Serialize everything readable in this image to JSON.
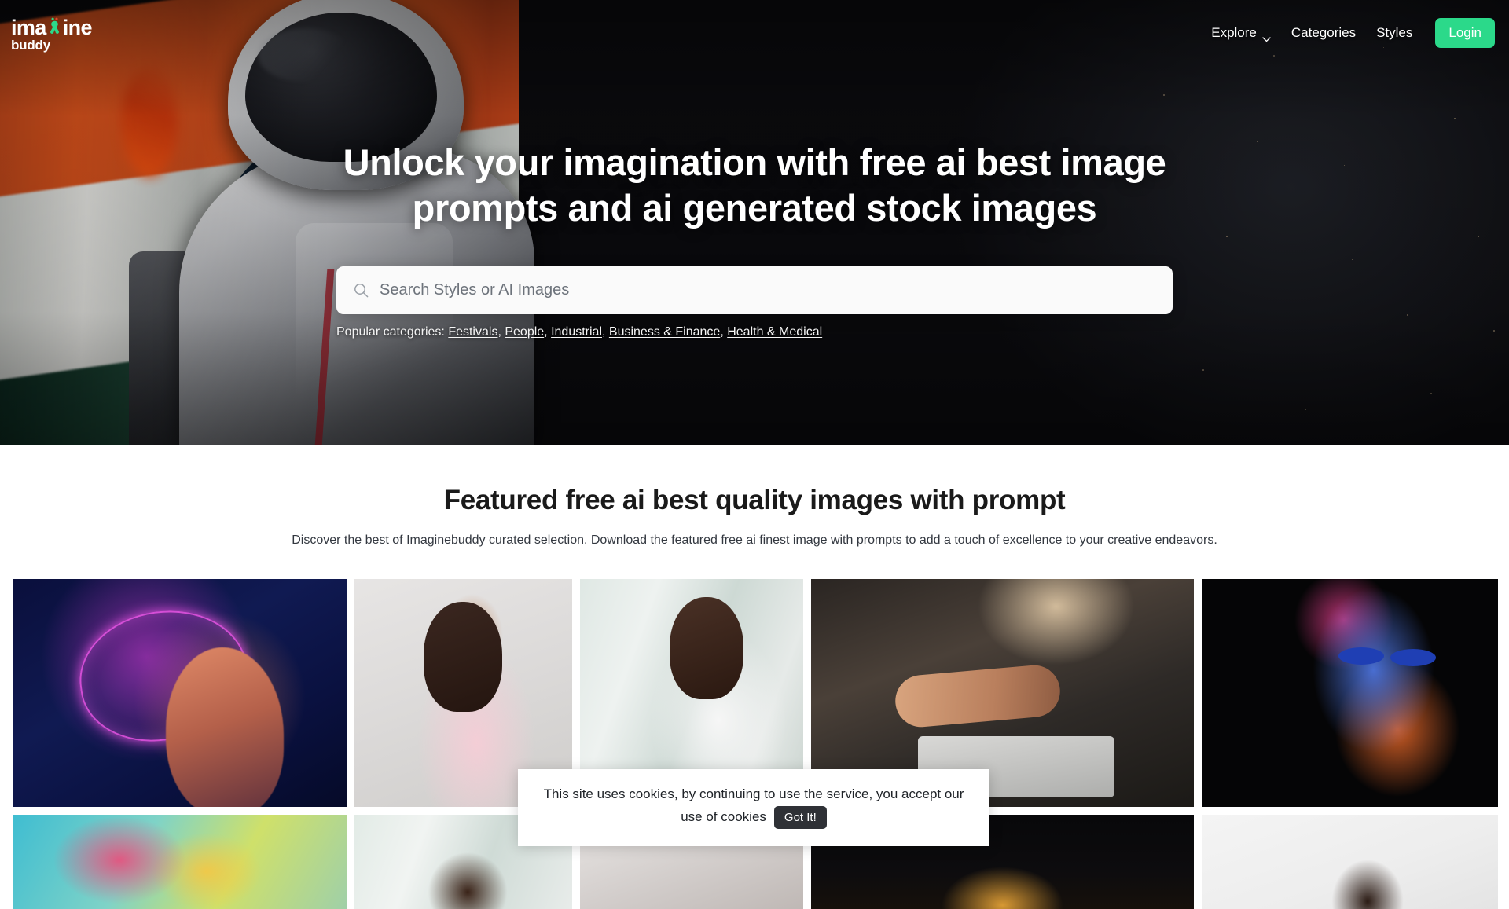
{
  "brand": {
    "logo_line1_a": "ima",
    "logo_line1_b": "ine",
    "logo_line2": "buddy",
    "accent_color": "#2BD98A"
  },
  "nav": {
    "explore": "Explore",
    "categories": "Categories",
    "styles": "Styles",
    "login": "Login"
  },
  "hero": {
    "title": "Unlock your imagination with free ai best image prompts and ai generated stock images",
    "search": {
      "placeholder": "Search Styles or AI Images",
      "value": ""
    },
    "popular_label": "Popular categories:",
    "popular_categories": [
      "Festivals",
      "People",
      "Industrial",
      "Business & Finance",
      "Health & Medical"
    ]
  },
  "featured": {
    "title": "Featured free ai best quality images with prompt",
    "subtitle": "Discover the best of Imaginebuddy curated selection. Download the featured free ai finest image with prompts to add a touch of excellence to your creative endeavors."
  },
  "gallery": {
    "columns": [
      {
        "tiles": [
          {
            "name": "ai-neural-brain-woman"
          },
          {
            "name": "holi-festival-colors"
          }
        ]
      },
      {
        "tiles": [
          {
            "name": "woman-pink-scarf-portrait"
          },
          {
            "name": "female-doctor-indoor"
          }
        ]
      },
      {
        "tiles": [
          {
            "name": "female-doctor-stethoscope"
          },
          {
            "name": "bright-light-scene"
          }
        ]
      },
      {
        "tiles": [
          {
            "name": "business-handshake-architecture"
          },
          {
            "name": "golden-coin-dark"
          }
        ]
      },
      {
        "tiles": [
          {
            "name": "neon-face-paint-art"
          },
          {
            "name": "studio-portrait-woman"
          }
        ]
      }
    ]
  },
  "cookie": {
    "message": "This site uses cookies, by continuing to use the service, you accept our use of cookies",
    "button": "Got It!"
  }
}
